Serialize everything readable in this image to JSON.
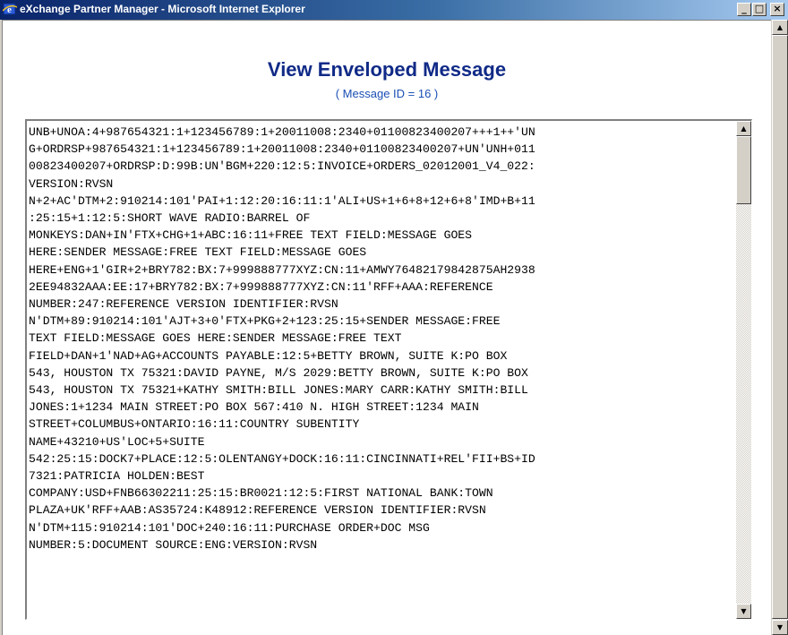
{
  "window": {
    "title": "eXchange Partner Manager - Microsoft Internet Explorer",
    "minimize_glyph": "_",
    "maximize_glyph": "□",
    "close_glyph": "×",
    "icon": "ie-icon"
  },
  "page": {
    "heading": "View Enveloped Message",
    "subheading": "( Message ID = 16 )"
  },
  "message": {
    "lines": [
      "UNB+UNOA:4+987654321:1+123456789:1+20011008:2340+01100823400207+++1++'UN",
      "G+ORDRSP+987654321:1+123456789:1+20011008:2340+01100823400207+UN'UNH+011",
      "00823400207+ORDRSP:D:99B:UN'BGM+220:12:5:INVOICE+ORDERS_02012001_V4_022:",
      "VERSION:RVSN",
      "N+2+AC'DTM+2:910214:101'PAI+1:12:20:16:11:1'ALI+US+1+6+8+12+6+8'IMD+B+11",
      ":25:15+1:12:5:SHORT WAVE RADIO:BARREL OF",
      "MONKEYS:DAN+IN'FTX+CHG+1+ABC:16:11+FREE TEXT FIELD:MESSAGE GOES",
      "HERE:SENDER MESSAGE:FREE TEXT FIELD:MESSAGE GOES",
      "HERE+ENG+1'GIR+2+BRY782:BX:7+999888777XYZ:CN:11+AMWY76482179842875AH2938",
      "2EE94832AAA:EE:17+BRY782:BX:7+999888777XYZ:CN:11'RFF+AAA:REFERENCE",
      "NUMBER:247:REFERENCE VERSION IDENTIFIER:RVSN",
      "N'DTM+89:910214:101'AJT+3+0'FTX+PKG+2+123:25:15+SENDER MESSAGE:FREE",
      "TEXT FIELD:MESSAGE GOES HERE:SENDER MESSAGE:FREE TEXT",
      "FIELD+DAN+1'NAD+AG+ACCOUNTS PAYABLE:12:5+BETTY BROWN, SUITE K:PO BOX",
      "543, HOUSTON TX 75321:DAVID PAYNE, M/S 2029:BETTY BROWN, SUITE K:PO BOX",
      "543, HOUSTON TX 75321+KATHY SMITH:BILL JONES:MARY CARR:KATHY SMITH:BILL",
      "JONES:1+1234 MAIN STREET:PO BOX 567:410 N. HIGH STREET:1234 MAIN",
      "STREET+COLUMBUS+ONTARIO:16:11:COUNTRY SUBENTITY",
      "NAME+43210+US'LOC+5+SUITE",
      "542:25:15:DOCK7+PLACE:12:5:OLENTANGY+DOCK:16:11:CINCINNATI+REL'FII+BS+ID",
      "7321:PATRICIA HOLDEN:BEST",
      "COMPANY:USD+FNB66302211:25:15:BR0021:12:5:FIRST NATIONAL BANK:TOWN",
      "PLAZA+UK'RFF+AAB:AS35724:K48912:REFERENCE VERSION IDENTIFIER:RVSN",
      "N'DTM+115:910214:101'DOC+240:16:11:PURCHASE ORDER+DOC MSG",
      "NUMBER:5:DOCUMENT SOURCE:ENG:VERSION:RVSN"
    ]
  },
  "scrollbar": {
    "up_arrow": "▲",
    "down_arrow": "▼"
  }
}
